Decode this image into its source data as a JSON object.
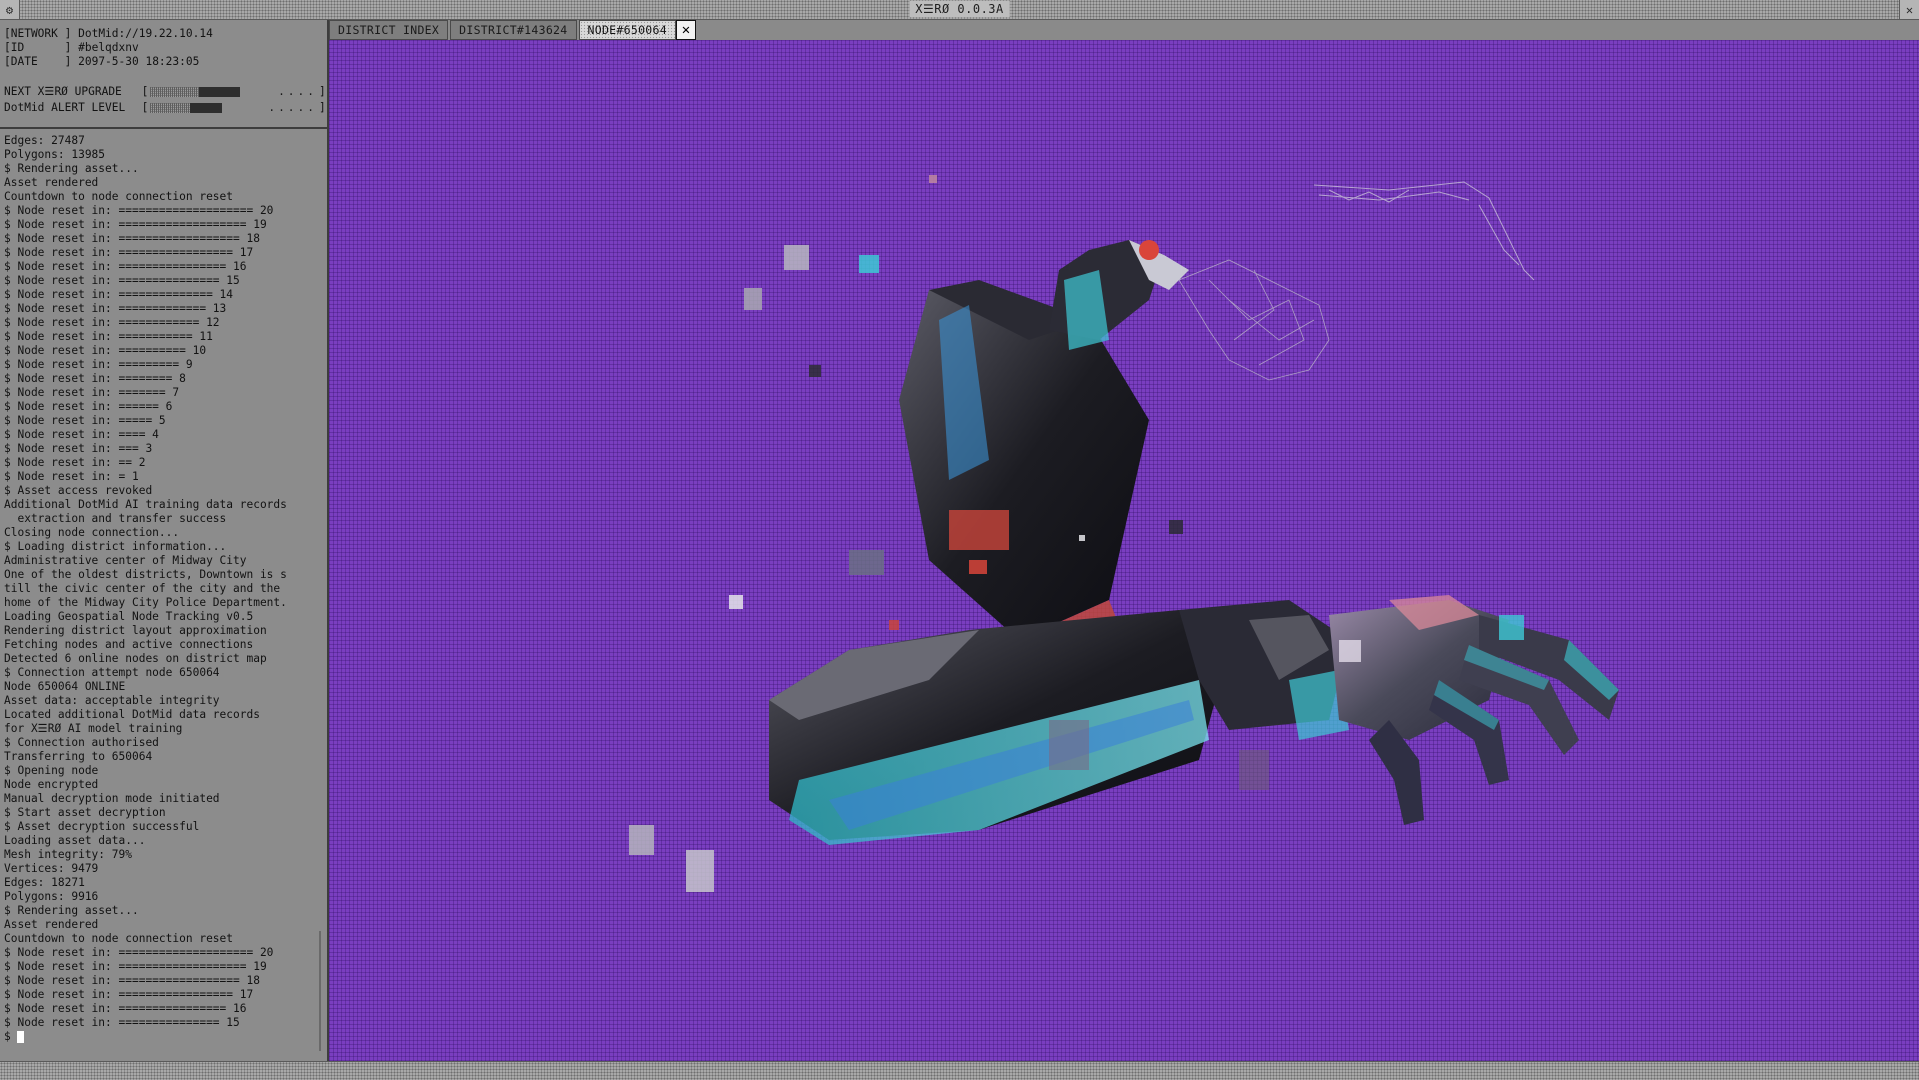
{
  "window": {
    "title": "X☰RØ 0.0.3A",
    "menu_icon": "system-menu-icon",
    "close_icon": "close-icon"
  },
  "status": {
    "network_label": "[NETWORK ]",
    "network_value": "DotMid://19.22.10.14",
    "id_label": "[ID      ]",
    "id_value": "#belqdxnv",
    "date_label": "[DATE    ]",
    "date_value": "2097-5-30 18:23:05"
  },
  "meters": {
    "upgrade_label": "NEXT X☰RØ UPGRADE",
    "upgrade_level": 0.8,
    "alert_label": "DotMid ALERT LEVEL",
    "alert_level": 0.64
  },
  "log": [
    "Edges: 27487",
    "Polygons: 13985",
    "$ Rendering asset...",
    "Asset rendered",
    "Countdown to node connection reset",
    "$ Node reset in: ==================== 20",
    "$ Node reset in: =================== 19",
    "$ Node reset in: ================== 18",
    "$ Node reset in: ================= 17",
    "$ Node reset in: ================ 16",
    "$ Node reset in: =============== 15",
    "$ Node reset in: ============== 14",
    "$ Node reset in: ============= 13",
    "$ Node reset in: ============ 12",
    "$ Node reset in: =========== 11",
    "$ Node reset in: ========== 10",
    "$ Node reset in: ========= 9",
    "$ Node reset in: ======== 8",
    "$ Node reset in: ======= 7",
    "$ Node reset in: ====== 6",
    "$ Node reset in: ===== 5",
    "$ Node reset in: ==== 4",
    "$ Node reset in: === 3",
    "$ Node reset in: == 2",
    "$ Node reset in: = 1",
    "$ Asset access revoked",
    "Additional DotMid AI training data records",
    "  extraction and transfer success",
    "Closing node connection...",
    "$ Loading district information...",
    "Administrative center of Midway City",
    "One of the oldest districts, Downtown is s",
    "till the civic center of the city and the",
    "home of the Midway City Police Department.",
    "Loading Geospatial Node Tracking v0.5",
    "Rendering district layout approximation",
    "Fetching nodes and active connections",
    "Detected 6 online nodes on district map",
    "$ Connection attempt node 650064",
    "Node 650064 ONLINE",
    "Asset data: acceptable integrity",
    "Located additional DotMid data records",
    "for X☰RØ AI model training",
    "$ Connection authorised",
    "Transferring to 650064",
    "$ Opening node",
    "Node encrypted",
    "Manual decryption mode initiated",
    "$ Start asset decryption",
    "$ Asset decryption successful",
    "Loading asset data...",
    "Mesh integrity: 79%",
    "Vertices: 9479",
    "Edges: 18271",
    "Polygons: 9916",
    "$ Rendering asset...",
    "Asset rendered",
    "Countdown to node connection reset",
    "$ Node reset in: ==================== 20",
    "$ Node reset in: =================== 19",
    "$ Node reset in: ================== 18",
    "$ Node reset in: ================= 17",
    "$ Node reset in: ================ 16",
    "$ Node reset in: =============== 15"
  ],
  "prompt": "$",
  "tabs": [
    {
      "label": "DISTRICT INDEX",
      "active": false
    },
    {
      "label": "DISTRICT#143624",
      "active": false
    },
    {
      "label": "NODE#650064",
      "active": true
    }
  ],
  "tab_close_glyph": "✕",
  "colors": {
    "viewport_bg": "#7a3ec0",
    "panel_bg": "#8c8c8c",
    "accent_cyan": "#3ec9d6",
    "accent_red": "#d9453a"
  }
}
